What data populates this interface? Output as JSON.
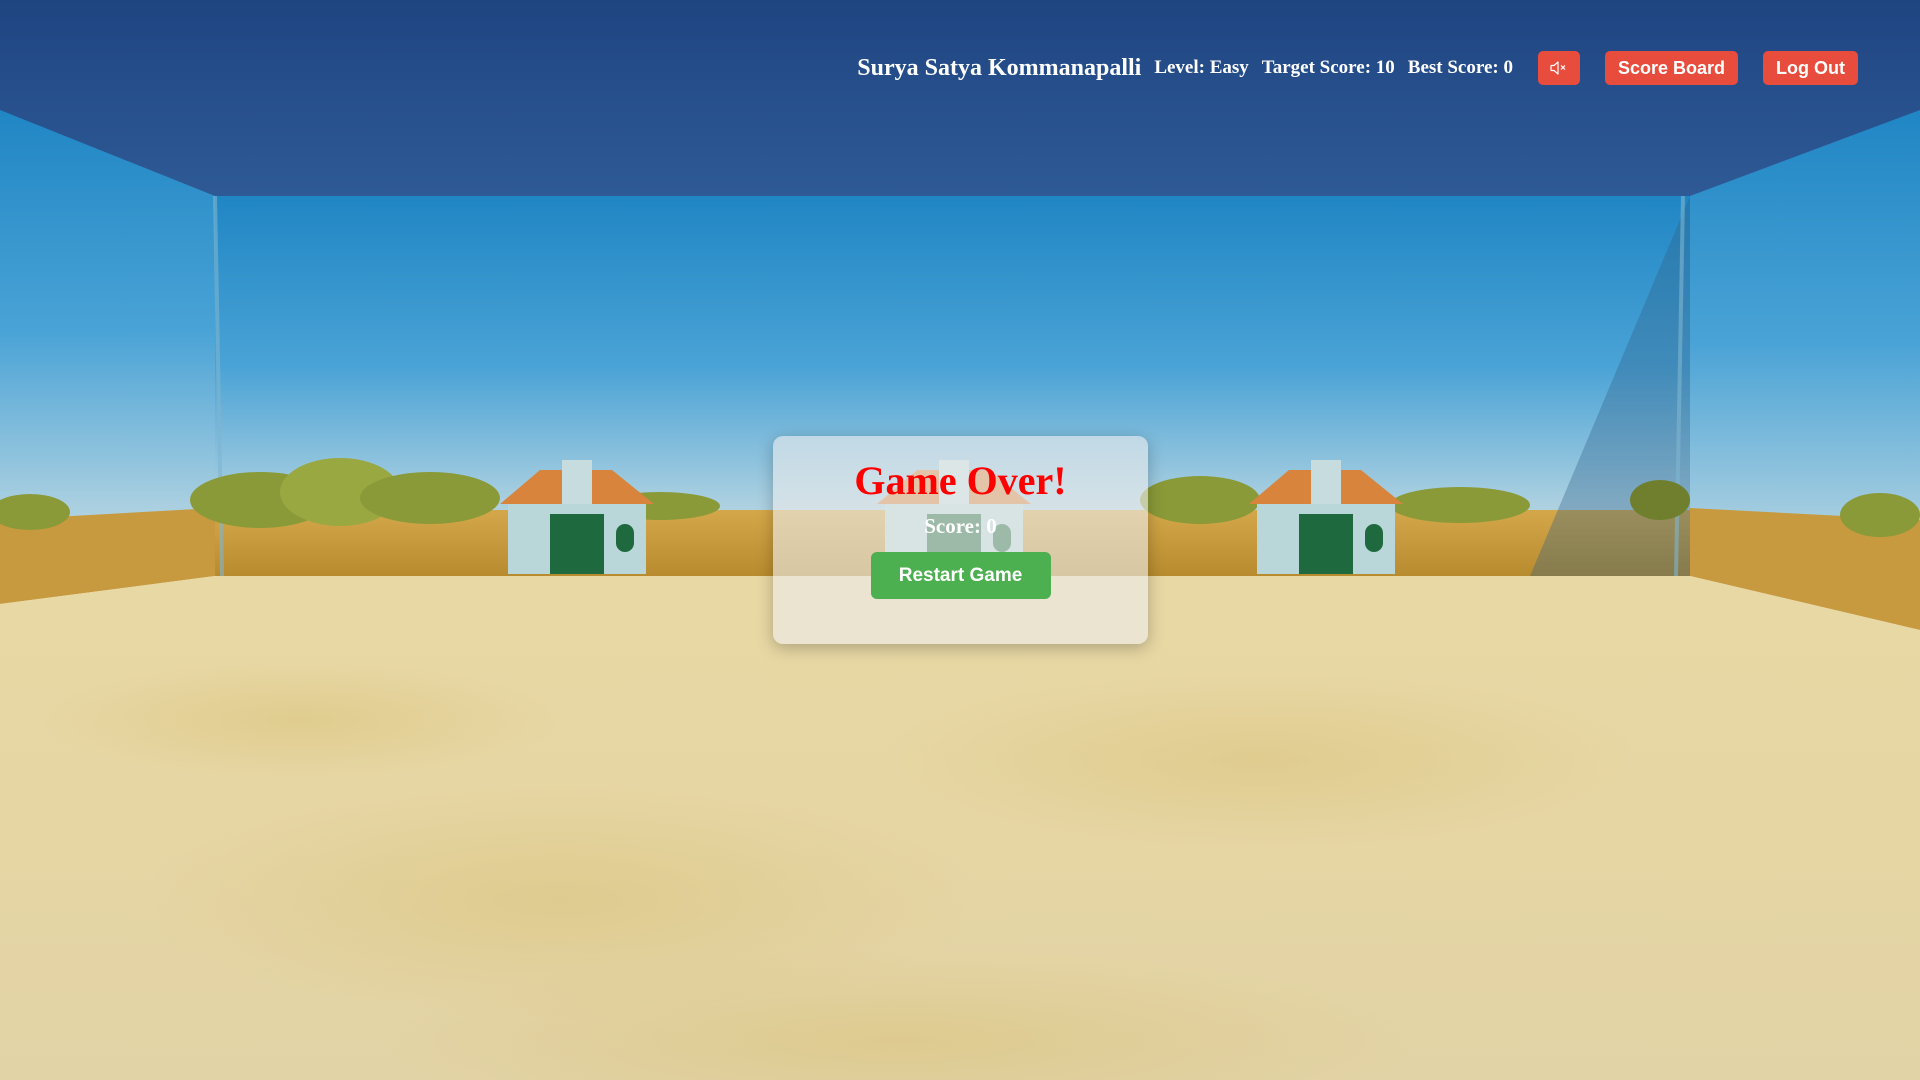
{
  "hud": {
    "player_name": "Surya Satya Kommanapalli",
    "level_text": "Level: Easy",
    "target_text": "Target Score: 10",
    "best_text": "Best Score: 0",
    "mute_icon": "speaker-muted-icon",
    "scoreboard_label": "Score Board",
    "logout_label": "Log Out"
  },
  "modal": {
    "title": "Game Over!",
    "score_text": "Score: 0",
    "restart_label": "Restart Game"
  },
  "colors": {
    "hud_button": "#e74c3c",
    "restart_button": "#4caf50",
    "game_over_text": "#ff0000"
  }
}
